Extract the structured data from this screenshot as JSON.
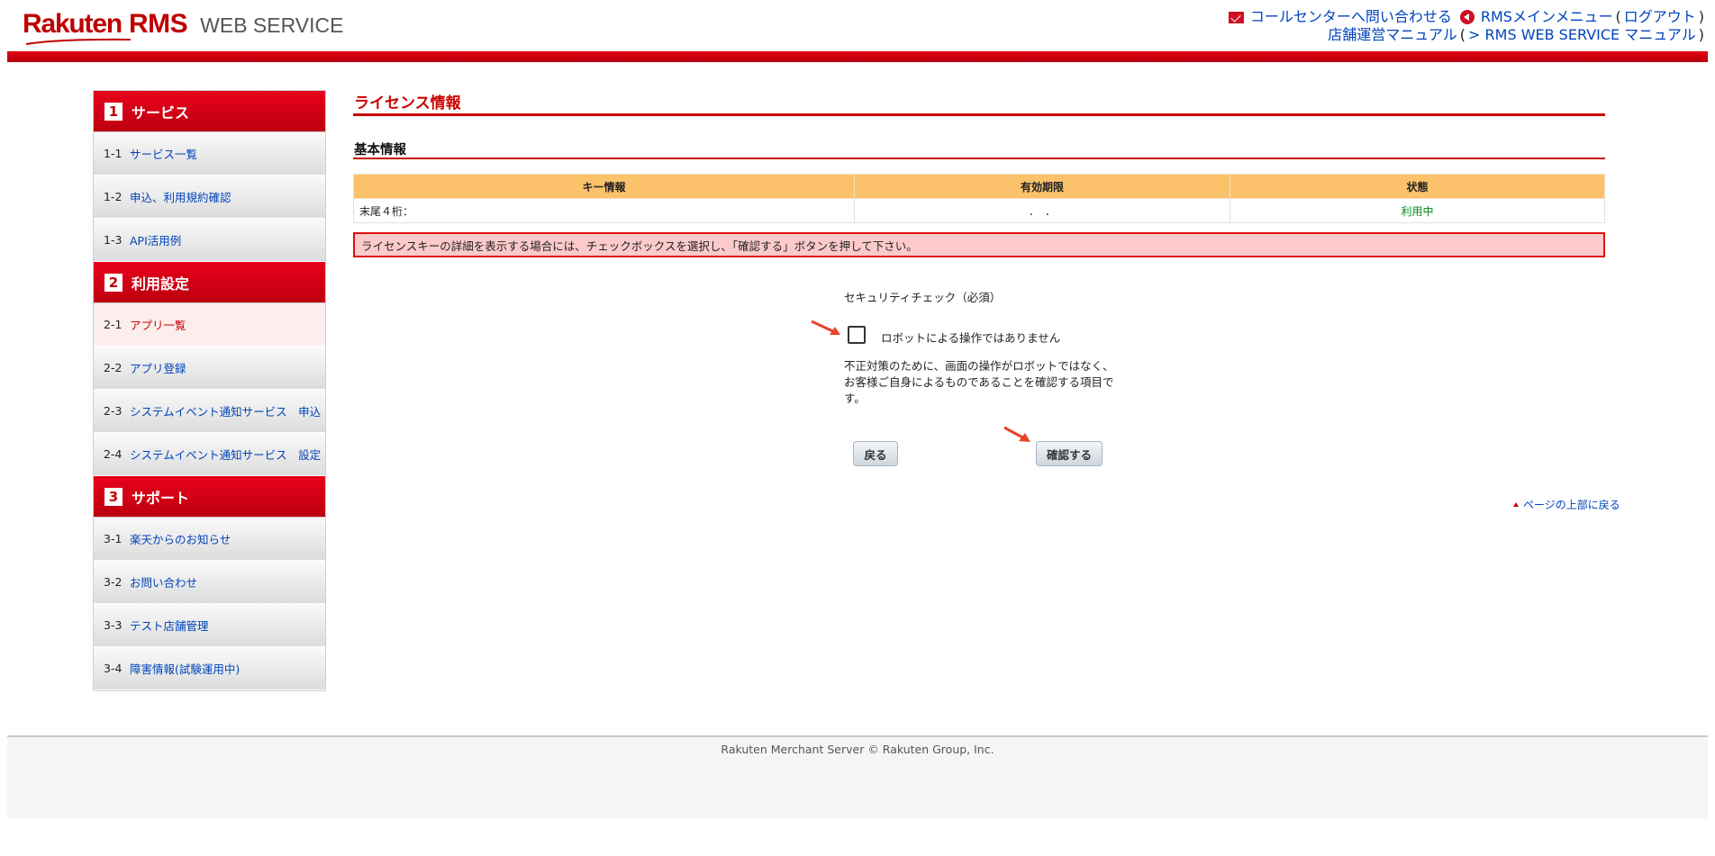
{
  "header": {
    "logo_rakuten": "Rakuten",
    "logo_rms": "RMS",
    "logo_webservice": "WEB SERVICE",
    "callcenter_link": "コールセンターへ問い合わせる",
    "main_menu_link": "RMSメインメニュー",
    "logout_link": "ログアウト",
    "manual_link": "店舗運営マニュアル",
    "ws_manual_link": "> RMS WEB SERVICE マニュアル",
    "paren_open": "(",
    "paren_close": ")"
  },
  "sidebar": {
    "sections": [
      {
        "num": "1",
        "title": "サービス",
        "items": [
          {
            "num": "1-1",
            "label": "サービス一覧"
          },
          {
            "num": "1-2",
            "label": "申込、利用規約確認"
          },
          {
            "num": "1-3",
            "label": "API活用例"
          }
        ]
      },
      {
        "num": "2",
        "title": "利用設定",
        "items": [
          {
            "num": "2-1",
            "label": "アプリ一覧"
          },
          {
            "num": "2-2",
            "label": "アプリ登録"
          },
          {
            "num": "2-3",
            "label": "システムイベント通知サービス　申込"
          },
          {
            "num": "2-4",
            "label": "システムイベント通知サービス　設定"
          }
        ]
      },
      {
        "num": "3",
        "title": "サポート",
        "items": [
          {
            "num": "3-1",
            "label": "楽天からのお知らせ"
          },
          {
            "num": "3-2",
            "label": "お問い合わせ"
          },
          {
            "num": "3-3",
            "label": "テスト店舗管理"
          },
          {
            "num": "3-4",
            "label": "障害情報(試験運用中)"
          }
        ]
      }
    ]
  },
  "main": {
    "page_title": "ライセンス情報",
    "section_title": "基本情報",
    "table": {
      "headers": [
        "キー情報",
        "有効期限",
        "状態"
      ],
      "row": {
        "key": "末尾４桁：",
        "expiry": "．　．",
        "status": "利用中"
      }
    },
    "notice": "ライセンスキーの詳細を表示する場合には、チェックボックスを選択し、「確認する」ボタンを押して下さい。",
    "security": {
      "label": "セキュリティチェック（必須）",
      "checkbox_label": "ロボットによる操作ではありません",
      "note": "不正対策のために、画面の操作がロボットではなく、お客様ご自身によるものであることを確認する項目です。"
    },
    "back_button": "戻る",
    "confirm_button": "確認する",
    "page_top_link": "ページの上部に戻る"
  },
  "footer": {
    "copyright": "Rakuten Merchant Server © Rakuten Group, Inc."
  },
  "colors": {
    "brand_red": "#bf0000",
    "table_header": "#fbc26b",
    "notice_bg": "#fccaca",
    "status_green": "#00891a",
    "link_blue": "#0044bb"
  }
}
